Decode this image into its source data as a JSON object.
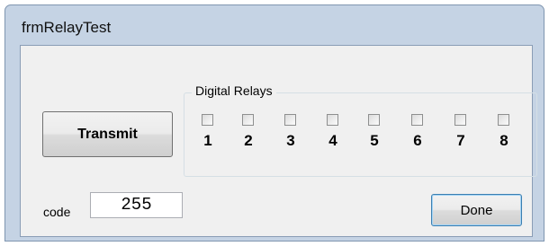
{
  "window": {
    "title": "frmRelayTest"
  },
  "transmit_button": {
    "label": "Transmit"
  },
  "relay_group": {
    "label": "Digital Relays",
    "relays": [
      {
        "number": "1",
        "checked": false
      },
      {
        "number": "2",
        "checked": false
      },
      {
        "number": "3",
        "checked": false
      },
      {
        "number": "4",
        "checked": false
      },
      {
        "number": "5",
        "checked": false
      },
      {
        "number": "6",
        "checked": false
      },
      {
        "number": "7",
        "checked": false
      },
      {
        "number": "8",
        "checked": false
      }
    ]
  },
  "code": {
    "label": "code",
    "value": "255"
  },
  "done_button": {
    "label": "Done"
  },
  "colors": {
    "title_bar": "#c5d3e4",
    "client_background": "#f0f0f0",
    "done_button_border": "#3c7fb1"
  }
}
